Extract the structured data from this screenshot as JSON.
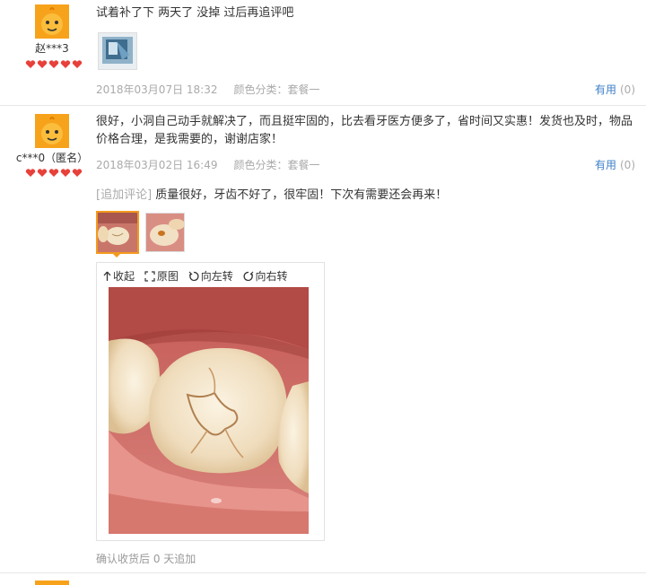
{
  "reviews": [
    {
      "username": "赵***3",
      "content": "试着补了下 两天了 没掉 过后再追评吧",
      "date": "2018年03月07日 18:32",
      "category": "颜色分类：套餐一",
      "useful_label": "有用",
      "useful_count": "(0)"
    },
    {
      "username": "c***0（匿名）",
      "content": "很好，小洞自己动手就解决了，而且挺牢固的，比去看牙医方便多了，省时间又实惠！发货也及时，物品价格合理，是我需要的，谢谢店家！",
      "date": "2018年03月02日 16:49",
      "category": "颜色分类：套餐一",
      "useful_label": "有用",
      "useful_count": "(0)",
      "append_tag": "[追加评论]",
      "append_text": "质量很好，牙齿不好了，很牢固！下次有需要还会再来！",
      "viewer_tools": {
        "collapse": "收起",
        "original": "原图",
        "rotate_left": "向左转",
        "rotate_right": "向右转"
      },
      "append_footer": "确认收货后 0 天追加"
    }
  ],
  "colors": {
    "accent_orange": "#f39a1e",
    "link_blue": "#3c7fc8",
    "heart_red": "#e8403a"
  }
}
